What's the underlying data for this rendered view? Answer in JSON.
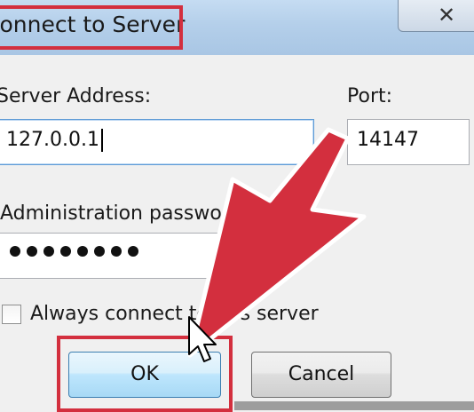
{
  "window": {
    "title": "Connect to Server",
    "close_icon": "close-icon"
  },
  "form": {
    "server_address_label": "Server Address:",
    "server_address_value": "127.0.0.1",
    "port_label": "Port:",
    "port_value": "14147",
    "password_label": "Administration passwo",
    "password_mask_count": 8,
    "checkbox_label": "Always connect to this server",
    "checkbox_checked": false
  },
  "buttons": {
    "ok_label": "OK",
    "cancel_label": "Cancel"
  },
  "annotations": {
    "highlight_color": "#d32f3e",
    "arrow_icon": "red-arrow-icon",
    "cursor_icon": "mouse-pointer-icon"
  }
}
